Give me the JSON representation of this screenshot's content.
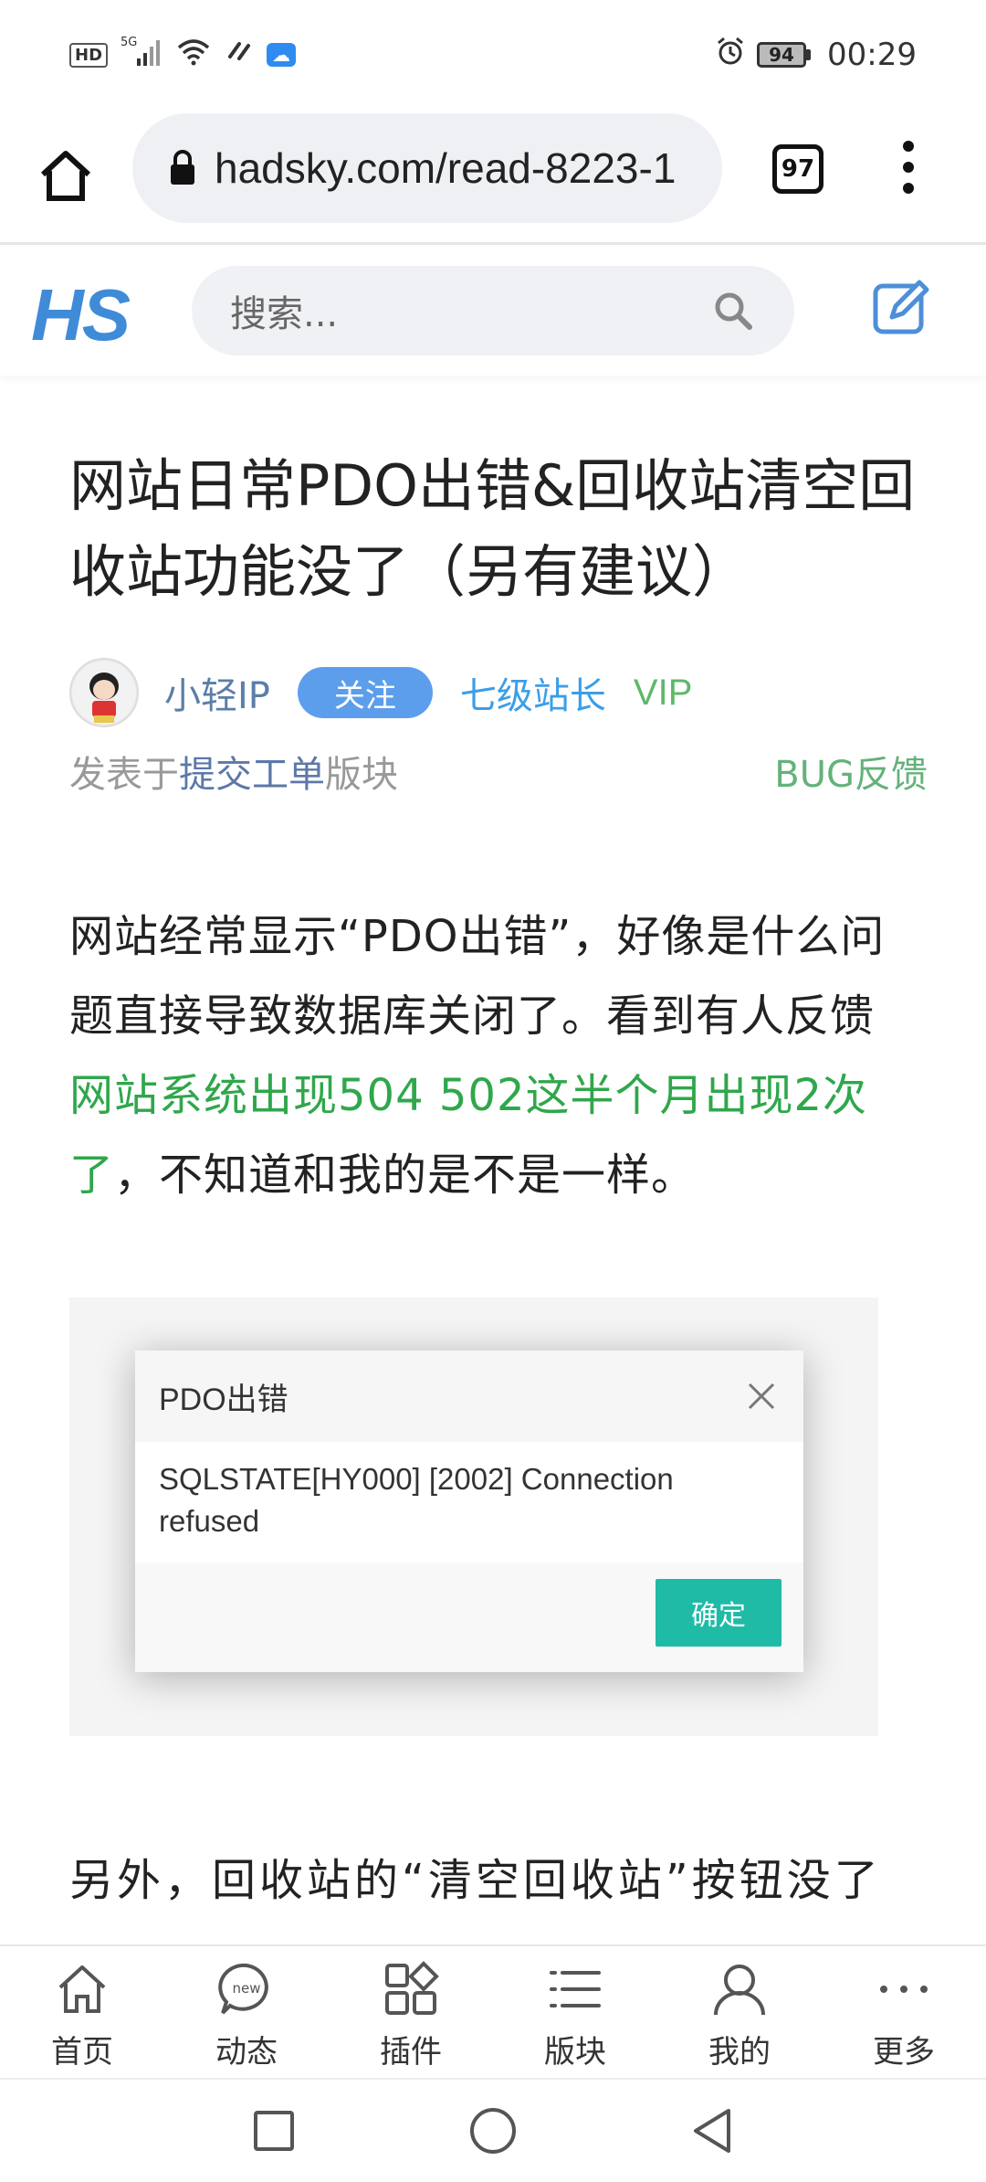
{
  "status_bar": {
    "hd": "HD",
    "network": "5G",
    "battery": "94",
    "time": "00:29"
  },
  "browser": {
    "url": "hadsky.com/read-8223-1",
    "tab_count": "97"
  },
  "site": {
    "logo": "HS",
    "search_placeholder": "搜索..."
  },
  "article": {
    "title": "网站日常PDO出错&回收站清空回收站功能没了（另有建议）",
    "author": "小轻IP",
    "follow_label": "关注",
    "level": "七级站长",
    "vip": "VIP",
    "meta_prefix": "发表于",
    "board": "提交工单",
    "meta_suffix": "版块",
    "tag": "BUG反馈",
    "para1_before": "网站经常显示“PDO出错”，好像是什么问题直接导致数据库关闭了。看到有人反馈 ",
    "para1_link": "网站系统出现504 502这半个月出现2次了",
    "para1_after": "，不知道和我的是不是一样。",
    "dialog": {
      "title": "PDO出错",
      "message": "SQLSTATE[HY000] [2002] Connection refused",
      "ok": "确定"
    },
    "para2": "另外，回收站的“清空回收站”按钮没了"
  },
  "bottom_nav": [
    {
      "label": "首页",
      "icon": "home-icon"
    },
    {
      "label": "动态",
      "icon": "new-chat-icon"
    },
    {
      "label": "插件",
      "icon": "apps-icon"
    },
    {
      "label": "版块",
      "icon": "list-icon"
    },
    {
      "label": "我的",
      "icon": "user-icon"
    },
    {
      "label": "更多",
      "icon": "more-icon"
    }
  ],
  "colors": {
    "link_green": "#2fa74b",
    "follow_blue": "#5c9eec",
    "level_blue": "#3b9ee8",
    "ok_teal": "#1fbba6"
  }
}
